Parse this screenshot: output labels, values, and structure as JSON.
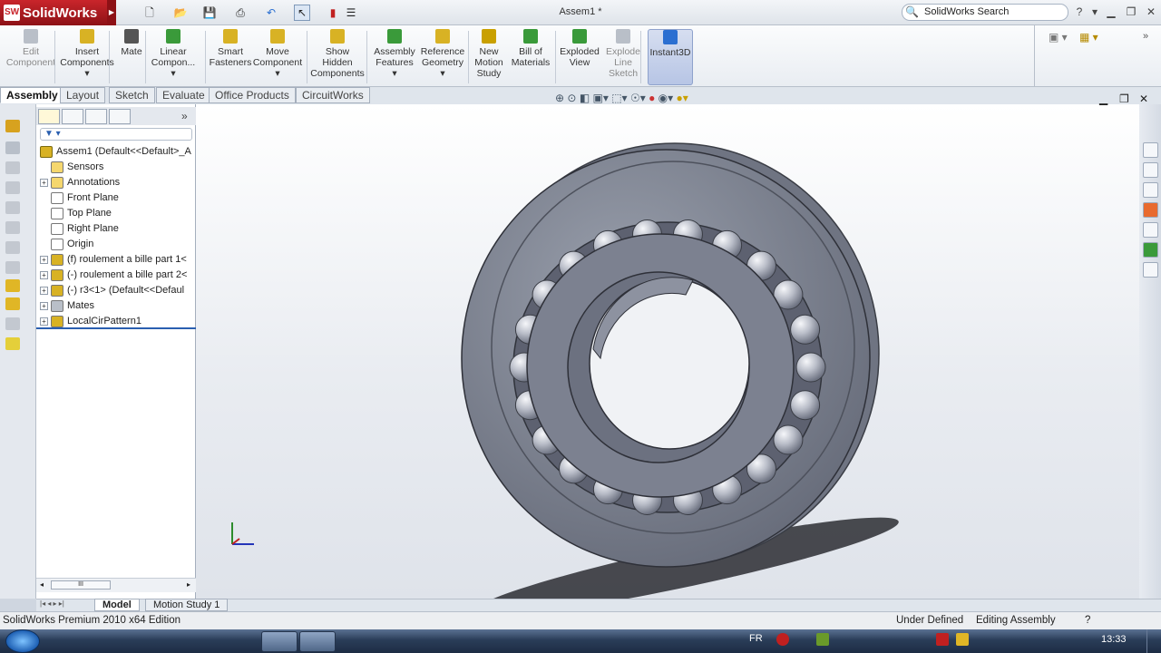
{
  "app": {
    "brand": "SolidWorks",
    "window_title": "Assem1 *",
    "search_placeholder": "SolidWorks Search"
  },
  "command_manager": [
    {
      "label1": "Edit",
      "label2": "Component",
      "label3": "",
      "enabled": false
    },
    {
      "label1": "Insert",
      "label2": "Components",
      "label3": "▾",
      "enabled": true
    },
    {
      "label1": "Mate",
      "label2": "",
      "label3": "",
      "enabled": true
    },
    {
      "label1": "Linear",
      "label2": "Compon...",
      "label3": "▾",
      "enabled": true
    },
    {
      "label1": "Smart",
      "label2": "Fasteners",
      "label3": "",
      "enabled": true
    },
    {
      "label1": "Move",
      "label2": "Component",
      "label3": "▾",
      "enabled": true
    },
    {
      "label1": "Show",
      "label2": "Hidden",
      "label3": "Components",
      "enabled": true
    },
    {
      "label1": "Assembly",
      "label2": "Features",
      "label3": "▾",
      "enabled": true
    },
    {
      "label1": "Reference",
      "label2": "Geometry",
      "label3": "▾",
      "enabled": true
    },
    {
      "label1": "New",
      "label2": "Motion",
      "label3": "Study",
      "enabled": true
    },
    {
      "label1": "Bill of",
      "label2": "Materials",
      "label3": "",
      "enabled": true
    },
    {
      "label1": "Exploded",
      "label2": "View",
      "label3": "",
      "enabled": true
    },
    {
      "label1": "Explode",
      "label2": "Line",
      "label3": "Sketch",
      "enabled": false
    },
    {
      "label1": "Instant3D",
      "label2": "",
      "label3": "",
      "enabled": true
    }
  ],
  "tabs": [
    "Assembly",
    "Layout",
    "Sketch",
    "Evaluate",
    "Office Products",
    "CircuitWorks"
  ],
  "active_tab": "Assembly",
  "feature_tree": {
    "root": "Assem1  (Default<<Default>_A",
    "items": [
      {
        "label": "Sensors",
        "expandable": false,
        "icon": "sensor-folder-icon"
      },
      {
        "label": "Annotations",
        "expandable": true,
        "icon": "annotations-icon"
      },
      {
        "label": "Front Plane",
        "expandable": false,
        "icon": "plane-icon"
      },
      {
        "label": "Top Plane",
        "expandable": false,
        "icon": "plane-icon"
      },
      {
        "label": "Right Plane",
        "expandable": false,
        "icon": "plane-icon"
      },
      {
        "label": "Origin",
        "expandable": false,
        "icon": "origin-icon"
      },
      {
        "label": "(f) roulement a bille part 1<",
        "expandable": true,
        "icon": "part-icon"
      },
      {
        "label": "(-) roulement a bille part 2<",
        "expandable": true,
        "icon": "part-icon"
      },
      {
        "label": "(-) r3<1> (Default<<Defaul",
        "expandable": true,
        "icon": "part-icon"
      },
      {
        "label": "Mates",
        "expandable": true,
        "icon": "mates-icon"
      },
      {
        "label": "LocalCirPattern1",
        "expandable": true,
        "icon": "pattern-icon"
      }
    ],
    "scroll_label": "III"
  },
  "bottom_tabs": [
    "Model",
    "Motion Study 1"
  ],
  "status": {
    "edition": "SolidWorks Premium 2010 x64 Edition",
    "state": "Under Defined",
    "mode": "Editing Assembly",
    "help": "?"
  },
  "taskbar": {
    "lang": "FR",
    "time": "13:33"
  },
  "colors": {
    "accent_red": "#c9252b",
    "part_gray": "#7a7f8e",
    "viewport_bg": "#e6e9ef"
  }
}
